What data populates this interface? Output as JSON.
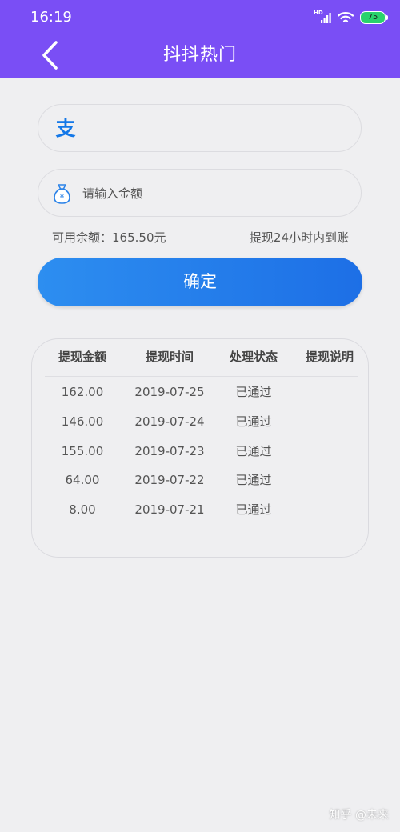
{
  "status_bar": {
    "time": "16:19",
    "network": "HD",
    "battery": "75"
  },
  "header": {
    "title": "抖抖热门"
  },
  "form": {
    "alipay_icon": "支",
    "amount_placeholder": "请输入金额",
    "available_balance": "可用余额：165.50元",
    "arrival_note": "提现24小时内到账",
    "confirm_label": "确定"
  },
  "records": {
    "headers": [
      "提现金额",
      "提现时间",
      "处理状态",
      "提现说明"
    ],
    "rows": [
      [
        "162.00",
        "2019-07-25",
        "已通过",
        ""
      ],
      [
        "146.00",
        "2019-07-24",
        "已通过",
        ""
      ],
      [
        "155.00",
        "2019-07-23",
        "已通过",
        ""
      ],
      [
        "64.00",
        "2019-07-22",
        "已通过",
        ""
      ],
      [
        "8.00",
        "2019-07-21",
        "已通过",
        ""
      ]
    ]
  },
  "watermark": "知乎 @未来",
  "colors": {
    "header": "#7a4ef5",
    "button": "#1d6fe6",
    "alipay": "#1478e8",
    "background": "#efeff1"
  },
  "icons": {
    "back": "chevron-left-icon",
    "alipay": "alipay-icon",
    "money_bag": "money-bag-icon",
    "signal": "signal-icon",
    "wifi": "wifi-icon",
    "battery": "battery-icon"
  }
}
